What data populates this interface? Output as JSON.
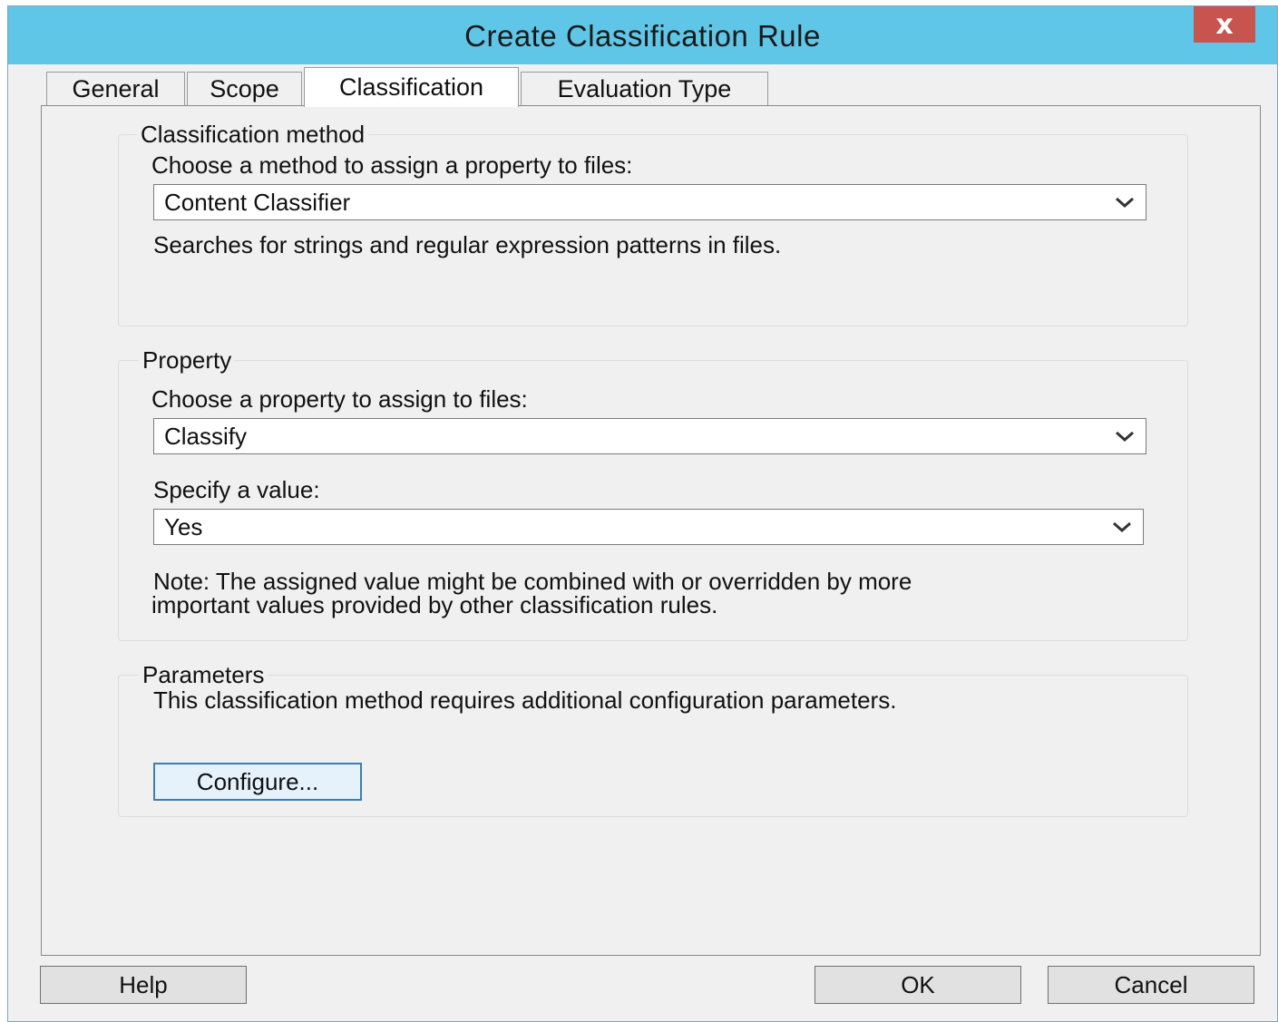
{
  "window": {
    "title": "Create Classification Rule",
    "close_label": "x"
  },
  "tabs": [
    {
      "label": "General",
      "active": false
    },
    {
      "label": "Scope",
      "active": false
    },
    {
      "label": "Classification",
      "active": true
    },
    {
      "label": "Evaluation Type",
      "active": false
    }
  ],
  "classification_method": {
    "legend": "Classification method",
    "prompt": "Choose a method to assign a property to files:",
    "selected": "Content Classifier",
    "description": "Searches for strings and regular expression patterns in files."
  },
  "property": {
    "legend": "Property",
    "prompt": "Choose a property to assign to files:",
    "selected": "Classify",
    "value_prompt": "Specify a value:",
    "value_selected": "Yes",
    "note_line1": "Note: The assigned value might be combined with or overridden by more",
    "note_line2": "important values provided by other classification rules."
  },
  "parameters": {
    "legend": "Parameters",
    "description": "This classification method requires additional configuration parameters.",
    "configure_label": "Configure..."
  },
  "footer": {
    "help_label": "Help",
    "ok_label": "OK",
    "cancel_label": "Cancel"
  },
  "icons": {
    "close": "close-icon",
    "dropdown": "chevron-down-icon"
  },
  "colors": {
    "titlebar": "#5fc6e8",
    "close_button": "#c85450",
    "dialog_bg": "#f0f0f0",
    "focus_border": "#3c7fb1"
  }
}
